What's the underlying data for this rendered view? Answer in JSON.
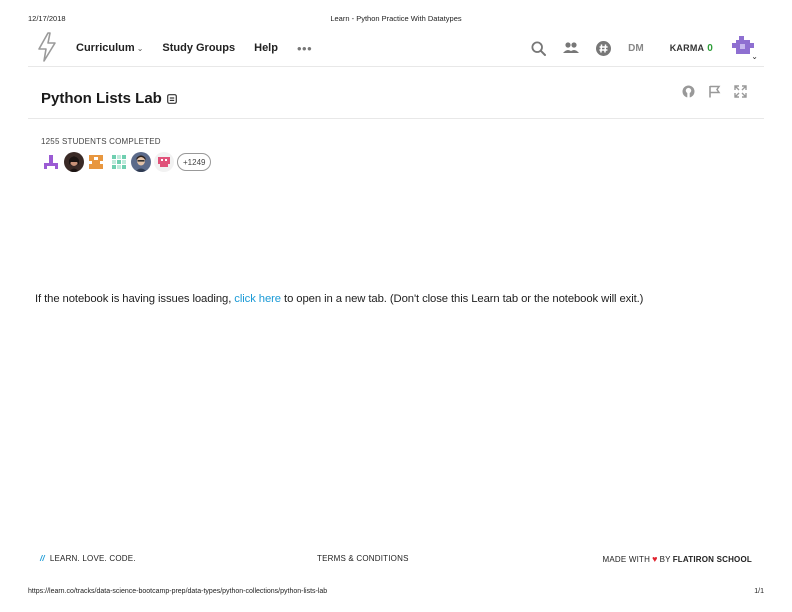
{
  "print_header": {
    "date": "12/17/2018",
    "doc_title": "Learn - Python Practice With Datatypes"
  },
  "navbar": {
    "logo_icon": "lightning-bolt-icon",
    "links": [
      {
        "label": "Curriculum",
        "has_dropdown": true
      },
      {
        "label": "Study Groups"
      },
      {
        "label": "Help"
      }
    ],
    "more_icon": "ellipsis-icon",
    "search_icon": "search-icon",
    "people_icon": "people-icon",
    "slack_icon": "hashtag-icon",
    "dm_label": "DM",
    "karma_label": "KARMA",
    "karma_value": "0",
    "avatar_icon": "user-avatar-icon",
    "karma_color": "#2e9e39"
  },
  "lesson": {
    "title": "Python Lists Lab",
    "badge_icon": "lab-badge-icon",
    "actions": [
      "github-icon",
      "flag-icon",
      "fullscreen-icon"
    ]
  },
  "completed": {
    "label": "1255 STUDENTS COMPLETED",
    "avatars": [
      "identicon-purple",
      "user-photo-1",
      "identicon-orange",
      "identicon-teal",
      "user-photo-2",
      "identicon-pink"
    ],
    "more_label": "+1249"
  },
  "notice": {
    "before": "If the notebook is having issues loading, ",
    "link": "click here",
    "after": " to open in a new tab. (Don't close this Learn tab or the notebook will exit.)",
    "link_color": "#1a9ad6"
  },
  "footer": {
    "slashes": "//",
    "tagline": "LEARN. LOVE. CODE.",
    "terms": "TERMS & CONDITIONS",
    "made_with": "MADE WITH",
    "heart": "♥",
    "by": "BY",
    "brand": "FLATIRON SCHOOL"
  },
  "print_footer": {
    "url": "https://learn.co/tracks/data-science-bootcamp-prep/data-types/python-collections/python-lists-lab",
    "page": "1/1"
  }
}
